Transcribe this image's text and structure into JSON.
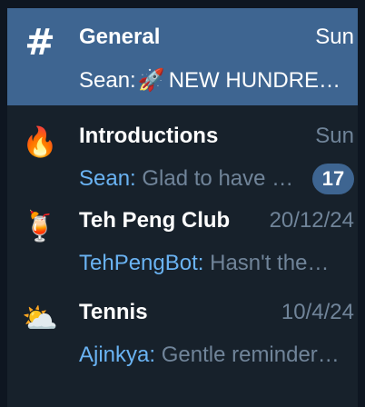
{
  "chats": [
    {
      "avatar_icon": "hash-icon",
      "avatar_glyph": "#",
      "title": "General",
      "date": "Sun",
      "sender": "Sean:",
      "preview_icon": "rocket-icon",
      "preview_glyph": "🚀",
      "preview": "NEW HUNDRED…",
      "active": true
    },
    {
      "avatar_icon": "fire-icon",
      "avatar_glyph": "🔥",
      "title": "Introductions",
      "date": "Sun",
      "sender": "Sean:",
      "preview": "Glad to have you here…",
      "unread_count": "17"
    },
    {
      "avatar_icon": "tropical-drink-icon",
      "avatar_glyph": "🍹",
      "title": "Teh Peng Club",
      "date": "20/12/24",
      "sender": "TehPengBot:",
      "preview": "Hasn't the…"
    },
    {
      "avatar_icon": "sun-behind-cloud-icon",
      "avatar_glyph": "⛅",
      "title": "Tennis",
      "date": "10/4/24",
      "sender": "Ajinkya:",
      "preview": "Gentle reminder…"
    }
  ],
  "colors": {
    "panel_bg": "#17212b",
    "active_bg": "#3e6591",
    "sender_blue": "#6ab3f3",
    "muted": "#708499",
    "badge_bg": "#3e6591"
  }
}
